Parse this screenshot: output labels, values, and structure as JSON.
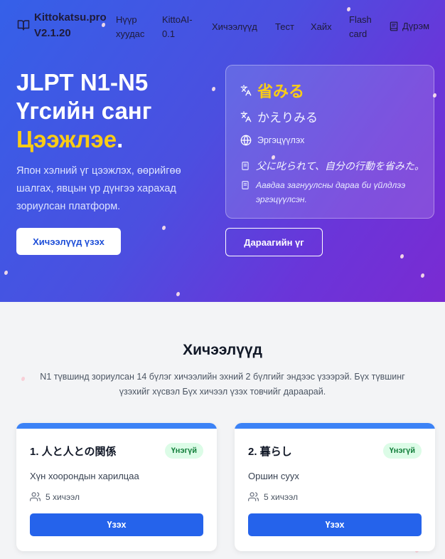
{
  "nav": {
    "brand_line1": "Kittokatsu.pro",
    "brand_line2": "V2.1.20",
    "home_line1": "Нүүр",
    "home_line2": "хуудас",
    "ai_line1": "KittoAI-",
    "ai_line2": "0.1",
    "lessons": "Хичээлүүд",
    "test": "Тест",
    "search": "Хайх",
    "flash_line1": "Flash",
    "flash_line2": "card",
    "dictionary": "Дүрэм"
  },
  "hero": {
    "title_line1": "JLPT N1-N5",
    "title_line2": "Үгсийн санг",
    "title_highlight": "Цээжлэе",
    "title_dot": ".",
    "subtitle": "Япон хэлний үг цээжлэх, өөрийгөө шалгах, явцын үр дүнгээ харахад зориулсан платформ.",
    "primary_button": "Хичээлүүд үзэх",
    "next_button": "Дараагийн үг"
  },
  "word_card": {
    "kanji": "省みる",
    "reading": "かえりみる",
    "meaning": "Эргэцүүлэх",
    "example_jp": "父に叱られて、自分の行動を省みた。",
    "example_mn": "Аавдаа загнуулсны дараа би үйлдлээ эргэцүүлсэн."
  },
  "lessons_section": {
    "title": "Хичээлүүд",
    "description": "N1 түвшинд зориулсан 14 бүлэг хичээлийн эхний 2 бүлгийг эндээс үзээрэй. Бүх түвшинг үзэхийг хүсвэл Бүх хичээл үзэх товчийг дараарай.",
    "cards": [
      {
        "title": "1. 人と人との関係",
        "badge": "Үнэгүй",
        "description": "Хүн хоорондын харилцаа",
        "count": "5 хичээл",
        "button": "Үзэх"
      },
      {
        "title": "2. 暮らし",
        "badge": "Үнэгүй",
        "description": "Оршин суух",
        "count": "5 хичээл",
        "button": "Үзэх"
      }
    ]
  },
  "colors": {
    "hero_gradient_start": "#3560e8",
    "hero_gradient_end": "#7a2bd2",
    "highlight": "#facc15",
    "primary": "#2563eb",
    "badge_bg": "#dcfce7",
    "badge_text": "#15803d"
  },
  "icons": [
    "book-open-icon",
    "book-icon",
    "translate-icon",
    "globe-icon",
    "document-icon",
    "users-icon"
  ]
}
